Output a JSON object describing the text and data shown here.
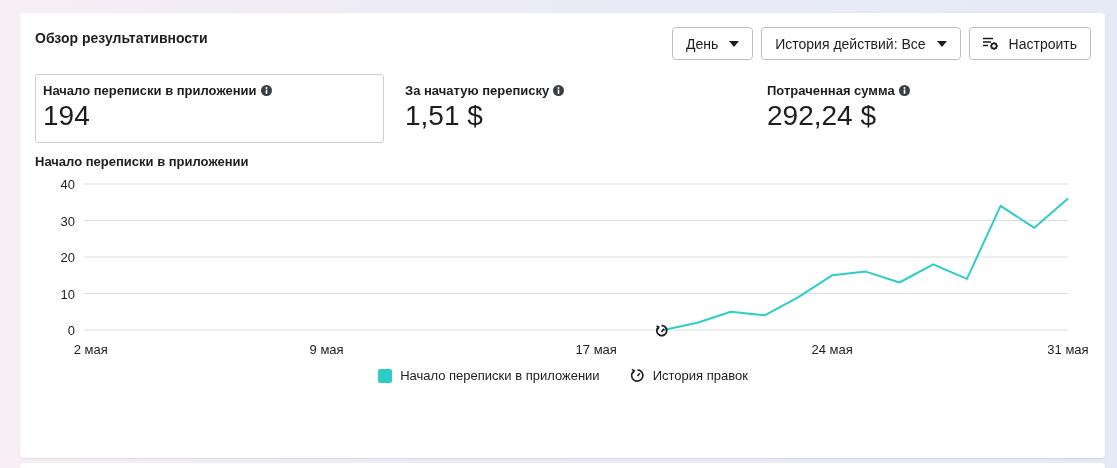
{
  "card": {
    "title": "Обзор результативности",
    "controls": [
      {
        "kind": "dropdown",
        "label": "День"
      },
      {
        "kind": "dropdown",
        "label": "История действий: Все"
      },
      {
        "kind": "settings",
        "label": "Настроить"
      }
    ],
    "metrics": [
      {
        "label": "Начало переписки в приложении",
        "value": "194",
        "selected": true
      },
      {
        "label": "За начатую переписку",
        "value": "1,51 $",
        "selected": false
      },
      {
        "label": "Потраченная сумма",
        "value": "292,24 $",
        "selected": false
      }
    ],
    "chart_title": "Начало переписки в приложении",
    "chart_data": {
      "type": "line",
      "x": [
        19,
        20,
        21,
        22,
        23,
        24,
        25,
        26,
        27,
        28,
        29,
        30,
        31
      ],
      "series": [
        {
          "name": "Начало переписки в приложении",
          "color": "#2ecdc6",
          "values": [
            0,
            2,
            5,
            4,
            9,
            15,
            16,
            13,
            18,
            14,
            34,
            28,
            36
          ]
        }
      ],
      "xlim": [
        1.8,
        31
      ],
      "ylim": [
        0,
        40
      ],
      "xticks": [
        {
          "value": 2,
          "label": "2 мая"
        },
        {
          "value": 9,
          "label": "9 мая"
        },
        {
          "value": 17,
          "label": "17 мая"
        },
        {
          "value": 24,
          "label": "24 мая"
        },
        {
          "value": 31,
          "label": "31 мая"
        }
      ],
      "yticks": [
        0,
        10,
        20,
        30,
        40
      ],
      "grid": true
    },
    "history_marker": true,
    "legend": [
      {
        "kind": "series"
      },
      {
        "kind": "history",
        "label": "История правок"
      }
    ]
  }
}
